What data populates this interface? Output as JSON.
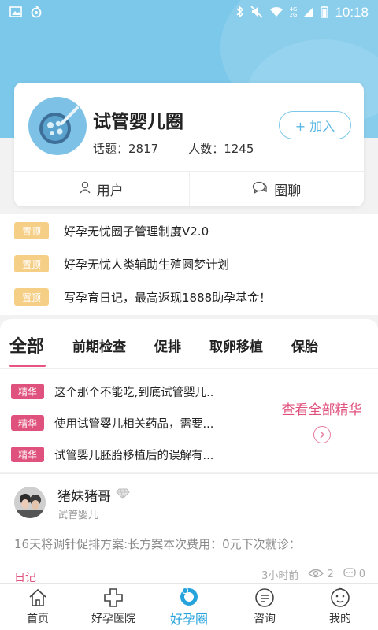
{
  "status_bar": {
    "time": "10:18",
    "icons": [
      "image-icon",
      "notification-icon",
      "bluetooth-icon",
      "mute-icon",
      "wifi-icon",
      "signal-4g-icon",
      "signal-2g-icon",
      "battery-icon"
    ],
    "net_4g": "4G",
    "net_2g": "2G"
  },
  "circle": {
    "name": "试管婴儿圈",
    "topics": "话题：2817",
    "members": "人数：1245",
    "join_label": "+ 加入",
    "tab_users": "用户",
    "tab_chat": "圈聊"
  },
  "pinned": {
    "badge": "置顶",
    "items": [
      "好孕无忧圈子管理制度V2.0",
      "好孕无忧人类辅助生殖圆梦计划",
      "写孕育日记，最高返现1888助孕基金！"
    ]
  },
  "categories": {
    "tabs": [
      "全部",
      "前期检查",
      "促排",
      "取卵移植",
      "保胎"
    ],
    "active_index": 0
  },
  "featured": {
    "badge": "精华",
    "items": [
      "这个那个不能吃,到底试管婴儿..",
      "使用试管婴儿相关药品，需要...",
      "试管婴儿胚胎移植后的误解有..."
    ],
    "view_all": "查看全部精华"
  },
  "post": {
    "user": "猪妹猪哥",
    "circle": "试管婴儿",
    "text": "16天将调针促排方案:长方案本次费用：0元下次就诊：",
    "tag": "日记",
    "time": "3小时前",
    "views": "2",
    "comments": "0"
  },
  "bottom_nav": {
    "items": [
      {
        "label": "首页",
        "icon": "home-icon"
      },
      {
        "label": "好孕医院",
        "icon": "hospital-cross-icon"
      },
      {
        "label": "好孕圈",
        "icon": "circle-icon"
      },
      {
        "label": "咨询",
        "icon": "consult-icon"
      },
      {
        "label": "我的",
        "icon": "profile-icon"
      }
    ],
    "active_index": 2
  },
  "colors": {
    "header": "#7cc8ea",
    "accent_pink": "#e0527e",
    "pin_badge": "#f6cf86",
    "nav_active": "#27a3dc"
  }
}
